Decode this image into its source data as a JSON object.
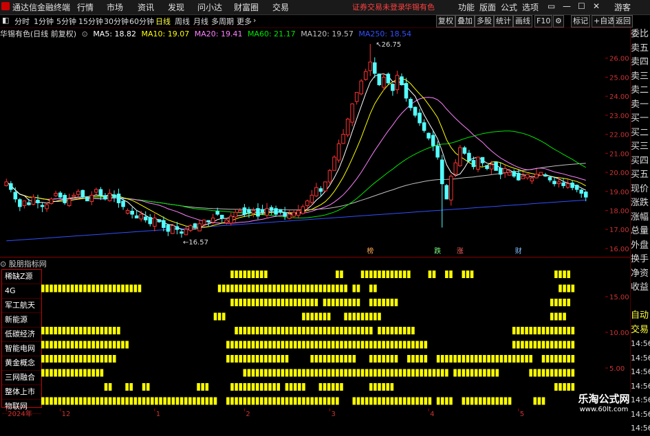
{
  "menubar": {
    "app_title": "通达信金融终端",
    "items": [
      "行情",
      "市场",
      "资讯",
      "发现",
      "问小达",
      "财富圈",
      "交易"
    ],
    "notice": "证券交易未登录",
    "stock": "华锡有色",
    "right_items": [
      "功能",
      "版面",
      "公式",
      "选项"
    ],
    "guest": "游客"
  },
  "toolbar": {
    "periods": [
      "分时",
      "1分钟",
      "5分钟",
      "15分钟",
      "30分钟",
      "60分钟",
      "日线",
      "周线",
      "月线",
      "多周期",
      "更多"
    ],
    "active_period": "日线",
    "buttons": [
      "复权",
      "叠加",
      "多股",
      "统计",
      "画线",
      "F10",
      "标记",
      "+自选",
      "返回"
    ]
  },
  "legend": {
    "title": "华锡有色(日线 前复权)",
    "ma5": "MA5: 18.82",
    "ma10": "MA10: 19.07",
    "ma20": "MA20: 19.41",
    "ma60": "MA60: 21.17",
    "ma120": "MA120: 19.57",
    "ma250": "MA250: 18.54"
  },
  "colors": {
    "up": "#ff3232",
    "down": "#54ffff",
    "ma5": "#ffffff",
    "ma10": "#ffff00",
    "ma20": "#ff80ff",
    "ma60": "#00e600",
    "ma120": "#c0c0c0",
    "ma250": "#3050ff",
    "bar": "#ffff00"
  },
  "chart_data": {
    "type": "candlestick",
    "ylim": [
      15.6,
      27.0
    ],
    "price_ticks": [
      "26.00",
      "25.00",
      "24.00",
      "23.00",
      "22.00",
      "21.00",
      "20.00",
      "19.00",
      "18.00",
      "17.00",
      "16.00"
    ],
    "high_label": "26.75",
    "low_label": "16.57",
    "signal_marks": [
      {
        "label": "榜",
        "color": "#ffaa55",
        "index": 81
      },
      {
        "label": "跌",
        "color": "#80ff80",
        "index": 96
      },
      {
        "label": "涨",
        "color": "#ff6060",
        "index": 101
      },
      {
        "label": "财",
        "color": "#80c0ff",
        "index": 114
      }
    ],
    "closes": [
      19.5,
      19.1,
      18.6,
      18.2,
      18.5,
      18.3,
      18.7,
      18.4,
      18.2,
      18.3,
      18.6,
      18.9,
      18.7,
      18.4,
      18.6,
      18.8,
      19.0,
      18.7,
      18.5,
      18.8,
      19.1,
      18.8,
      18.6,
      18.9,
      18.7,
      18.4,
      18.2,
      18.0,
      17.8,
      17.6,
      17.8,
      17.5,
      17.3,
      17.6,
      17.4,
      17.1,
      16.9,
      17.2,
      17.0,
      16.8,
      17.0,
      17.2,
      17.1,
      17.3,
      17.5,
      17.4,
      17.6,
      17.8,
      17.6,
      17.5,
      17.7,
      17.9,
      18.0,
      17.8,
      17.9,
      18.0,
      17.7,
      17.9,
      18.1,
      18.0,
      17.8,
      17.9,
      17.7,
      17.8,
      17.9,
      18.0,
      18.2,
      18.5,
      18.8,
      19.2,
      19.0,
      19.5,
      20.1,
      20.8,
      21.5,
      22.0,
      22.8,
      23.6,
      24.2,
      24.8,
      25.3,
      25.8,
      25.2,
      24.6,
      25.0,
      24.7,
      24.3,
      25.1,
      24.6,
      23.9,
      23.4,
      23.0,
      22.6,
      22.2,
      21.8,
      21.4,
      20.8,
      19.4,
      18.6,
      19.8,
      20.5,
      21.3,
      21.0,
      20.6,
      20.3,
      20.8,
      20.5,
      20.2,
      20.4,
      20.1,
      19.9,
      20.2,
      20.0,
      19.8,
      19.6,
      19.8,
      19.9,
      19.7,
      19.9,
      20.0,
      19.8,
      19.6,
      19.4,
      19.5,
      19.3,
      19.4,
      19.2,
      19.1,
      18.9,
      18.7
    ],
    "ma250_start": 16.4,
    "ma250_end": 18.55,
    "time_labels": [
      {
        "label": "2024年",
        "index": 0
      },
      {
        "label": "12",
        "index": 12
      },
      {
        "label": "1",
        "index": 33
      },
      {
        "label": "2",
        "index": 53
      },
      {
        "label": "3",
        "index": 72
      },
      {
        "label": "4",
        "index": 94
      },
      {
        "label": "5",
        "index": 114
      }
    ]
  },
  "indicator": {
    "title": "股朋指标网",
    "labels": [
      "稀缺Z源",
      "4G",
      "军工航天",
      "新能源",
      "低碳经济",
      "智能电网",
      "黄金概念",
      "三网融合",
      "整体上市",
      "物联网"
    ],
    "ticks": [
      "15.00",
      "10.00",
      "5.00"
    ],
    "rows": [
      [
        [
          45,
          53
        ],
        [
          70,
          71
        ],
        [
          76,
          87
        ],
        [
          92,
          93
        ],
        [
          96,
          97
        ],
        [
          100,
          102
        ],
        [
          122,
          125
        ]
      ],
      [
        [
          0,
          23
        ],
        [
          42,
          72
        ],
        [
          74,
          75
        ],
        [
          78,
          79
        ],
        [
          123,
          126
        ]
      ],
      [
        [
          45,
          63
        ],
        [
          63,
          65
        ],
        [
          67,
          75
        ],
        [
          78,
          84
        ],
        [
          121,
          125
        ]
      ],
      [
        [
          41,
          43
        ],
        [
          62,
          68
        ],
        [
          72,
          80
        ],
        [
          121,
          124
        ]
      ],
      [
        [
          0,
          18
        ],
        [
          46,
          78
        ],
        [
          80,
          88
        ],
        [
          112,
          126
        ]
      ],
      [
        [
          0,
          20
        ],
        [
          44,
          79
        ],
        [
          80,
          91
        ],
        [
          112,
          126
        ]
      ],
      [
        [
          0,
          17
        ],
        [
          44,
          58
        ],
        [
          64,
          74
        ],
        [
          78,
          84
        ],
        [
          87,
          91
        ],
        [
          94,
          116
        ],
        [
          119,
          124
        ],
        [
          125,
          126
        ]
      ],
      [
        [
          0,
          14
        ],
        [
          48,
          96
        ],
        [
          98,
          108
        ],
        [
          116,
          126
        ]
      ],
      [
        [
          15,
          16
        ],
        [
          20,
          21
        ],
        [
          24,
          25
        ],
        [
          37,
          39
        ],
        [
          45,
          56
        ],
        [
          58,
          62
        ],
        [
          66,
          71
        ],
        [
          78,
          83
        ],
        [
          122,
          126
        ]
      ],
      [
        [
          0,
          41
        ],
        [
          44,
          70
        ],
        [
          74,
          87
        ],
        [
          88,
          92
        ],
        [
          94,
          97
        ],
        [
          100,
          111
        ],
        [
          117,
          119
        ]
      ]
    ]
  },
  "right_panel": [
    "委比",
    "卖五",
    "卖四",
    "卖三",
    "卖二",
    "卖一",
    "买一",
    "买二",
    "买三",
    "买四",
    "买五",
    "现价",
    "涨跌",
    "涨幅",
    "总量",
    "外盘",
    "换手",
    "净资",
    "收益",
    "",
    "自动",
    "交易",
    "14:56",
    "14:56",
    "14:56",
    "14:56",
    "14:56",
    "14:56",
    "14:56"
  ],
  "watermark": {
    "title": "乐淘公式网",
    "url": "www.60lt.com"
  }
}
